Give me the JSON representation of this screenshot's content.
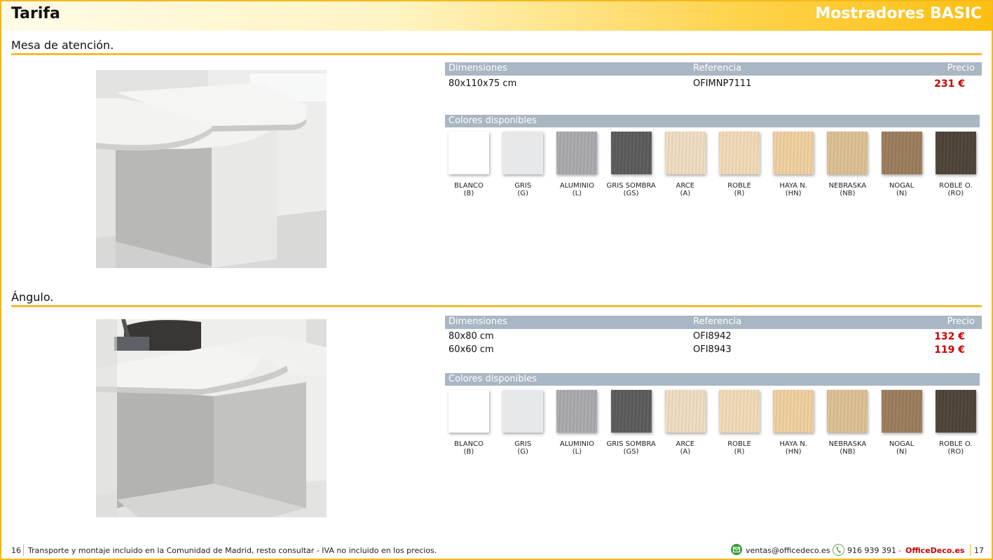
{
  "header": {
    "left_title": "Tarifa",
    "right_title": "Mostradores BASIC"
  },
  "sections": [
    {
      "title": "Mesa de atención.",
      "table": {
        "headers": [
          "Dimensiones",
          "Referencia",
          "Precio"
        ],
        "rows": [
          {
            "dimensions": "80x110x75 cm",
            "reference": "OFIMNP7111",
            "price": "231 €"
          }
        ]
      },
      "colors_title": "Colores disponibles"
    },
    {
      "title": "Ángulo.",
      "table": {
        "headers": [
          "Dimensiones",
          "Referencia",
          "Precio"
        ],
        "rows": [
          {
            "dimensions": "80x80 cm",
            "reference": "OFI8942",
            "price": "132 €"
          },
          {
            "dimensions": "60x60 cm",
            "reference": "OFI8943",
            "price": "119 €"
          }
        ]
      },
      "colors_title": "Colores disponibles"
    }
  ],
  "colors": [
    {
      "name": "BLANCO",
      "code": "(B)",
      "hex": "#ffffff"
    },
    {
      "name": "GRIS",
      "code": "(G)",
      "hex": "#e6e8ea"
    },
    {
      "name": "ALUMINIO",
      "code": "(L)",
      "hex": "#a9a9ad"
    },
    {
      "name": "GRIS SOMBRA",
      "code": "(GS)",
      "hex": "#5b5a5a"
    },
    {
      "name": "ARCE",
      "code": "(A)",
      "hex": "#efdcbf"
    },
    {
      "name": "ROBLE",
      "code": "(R)",
      "hex": "#f0d9b4"
    },
    {
      "name": "HAYA N.",
      "code": "(HN)",
      "hex": "#efcf9e"
    },
    {
      "name": "NEBRASKA",
      "code": "(NB)",
      "hex": "#dcbf92"
    },
    {
      "name": "NOGAL",
      "code": "(N)",
      "hex": "#9a7c5b"
    },
    {
      "name": "ROBLE O.",
      "code": "(RO)",
      "hex": "#4d4237"
    }
  ],
  "footer": {
    "page_left": "16",
    "note": "Transporte y montaje incluido en la Comunidad de Madrid, resto consultar - IVA no incluido en los precios.",
    "email": "ventas@officedeco.es",
    "phone": "916 939 391",
    "separator": "-",
    "brand": "OfficeDeco.es",
    "page_right": "17"
  },
  "accent_color": "#f2b31a",
  "price_color": "#cc0000"
}
